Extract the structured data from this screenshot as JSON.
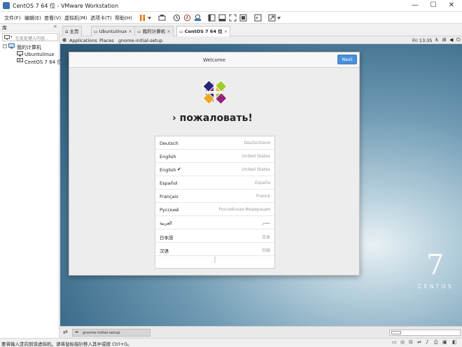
{
  "window": {
    "title": "CentOS 7 64 位 - VMware Workstation",
    "controls": {
      "minimize": "—",
      "maximize": "☐",
      "close": "✕"
    }
  },
  "menu": {
    "items": [
      "文件(F)",
      "编辑(E)",
      "查看(V)",
      "虚拟机(M)",
      "选项卡(T)",
      "帮助(H)"
    ]
  },
  "library": {
    "header": "库",
    "search_placeholder": "在此处键入内容...",
    "tree": {
      "root": "我的计算机",
      "children": [
        "Ubuntulinux",
        "CentOS 7 64 位"
      ]
    }
  },
  "tabs": [
    {
      "label": "主页",
      "active": false
    },
    {
      "label": "Ubuntulinux",
      "active": false
    },
    {
      "label": "我的计算机",
      "active": false
    },
    {
      "label": "CentOS 7 64 位",
      "active": true
    }
  ],
  "gnome": {
    "applications": "Applications",
    "places": "Places",
    "app_name": "gnome-initial-setup",
    "clock": "Fri 13:35"
  },
  "dialog": {
    "title": "Welcome",
    "next": "Next",
    "welcome_text": "› пожаловать!",
    "languages": [
      {
        "name": "Deutsch",
        "region": "Deutschland",
        "checked": false
      },
      {
        "name": "English",
        "region": "United States",
        "checked": false
      },
      {
        "name": "English",
        "region": "United States",
        "checked": true
      },
      {
        "name": "Español",
        "region": "España",
        "checked": false
      },
      {
        "name": "Français",
        "region": "France",
        "checked": false
      },
      {
        "name": "Русский",
        "region": "Российская Федерация",
        "checked": false
      },
      {
        "name": "العربية",
        "region": "مصر",
        "checked": false
      },
      {
        "name": "日本語",
        "region": "日本",
        "checked": false
      },
      {
        "name": "汉语",
        "region": "中国",
        "checked": false
      }
    ],
    "more": "⋮",
    "check_glyph": "✔"
  },
  "desktop": {
    "logo_number": "7",
    "logo_text": "CENTOS"
  },
  "vm_status": {
    "task": "gnome-initial-setup"
  },
  "statusbar": {
    "text": "要将输入定向到该虚拟机，请将鼠标指针移入其中或按 Ctrl+G。"
  },
  "colors": {
    "accent": "#4a90d9",
    "pause": "#e8730c",
    "titlebar_icon": "#3b6fb6"
  }
}
